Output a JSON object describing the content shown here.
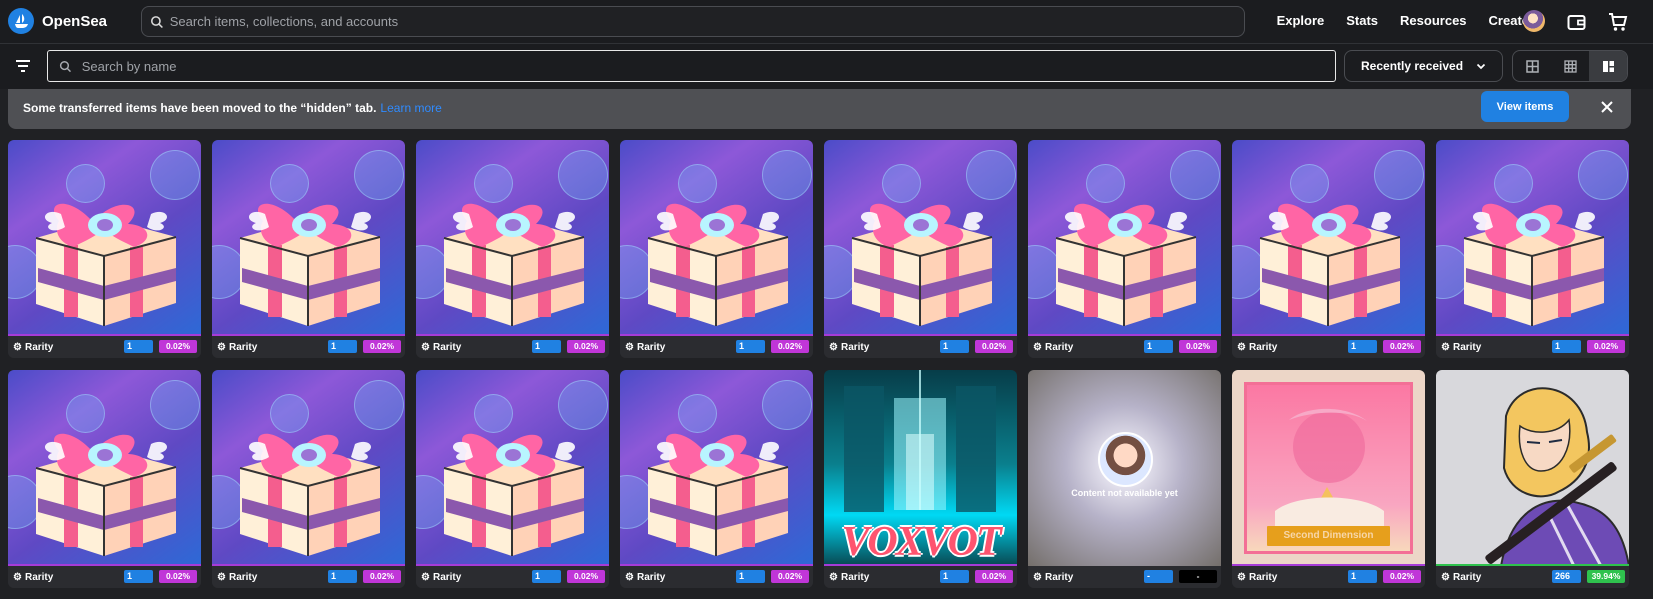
{
  "brand": {
    "name": "OpenSea"
  },
  "header": {
    "search_placeholder": "Search items, collections, and accounts",
    "nav": [
      "Explore",
      "Stats",
      "Resources",
      "Create"
    ]
  },
  "toolbar": {
    "name_search_placeholder": "Search by name",
    "sort_selected": "Recently received"
  },
  "banner": {
    "message": "Some transferred items have been moved to the “hidden” tab.",
    "link": "Learn more",
    "button": "View items"
  },
  "grid": {
    "cards": [
      {
        "rarity_label": "Rarity",
        "rank": "1",
        "percent": "0.02%",
        "media": "gift box"
      },
      {
        "rarity_label": "Rarity",
        "rank": "1",
        "percent": "0.02%",
        "media": "gift box"
      },
      {
        "rarity_label": "Rarity",
        "rank": "1",
        "percent": "0.02%",
        "media": "gift box"
      },
      {
        "rarity_label": "Rarity",
        "rank": "1",
        "percent": "0.02%",
        "media": "gift box"
      },
      {
        "rarity_label": "Rarity",
        "rank": "1",
        "percent": "0.02%",
        "media": "gift box"
      },
      {
        "rarity_label": "Rarity",
        "rank": "1",
        "percent": "0.02%",
        "media": "gift box"
      },
      {
        "rarity_label": "Rarity",
        "rank": "1",
        "percent": "0.02%",
        "media": "gift box"
      },
      {
        "rarity_label": "Rarity",
        "rank": "1",
        "percent": "0.02%",
        "media": "gift box"
      },
      {
        "rarity_label": "Rarity",
        "rank": "1",
        "percent": "0.02%",
        "media": "gift box"
      },
      {
        "rarity_label": "Rarity",
        "rank": "1",
        "percent": "0.02%",
        "media": "gift box"
      },
      {
        "rarity_label": "Rarity",
        "rank": "1",
        "percent": "0.02%",
        "media": "gift box"
      },
      {
        "rarity_label": "Rarity",
        "rank": "1",
        "percent": "0.02%",
        "media": "gift box"
      },
      {
        "rarity_label": "Rarity",
        "rank": "1",
        "percent": "0.02%",
        "media": "VoxVot artwork",
        "title": "VOXVOT"
      },
      {
        "rarity_label": "Rarity",
        "rank": "-",
        "percent": "-",
        "media": "content unavailable",
        "message": "Content not available yet"
      },
      {
        "rarity_label": "Rarity",
        "rank": "1",
        "percent": "0.02%",
        "media": "Second Dimension card",
        "title": "Second Dimension"
      },
      {
        "rarity_label": "Rarity",
        "rank": "266",
        "percent": "39.94%",
        "media": "samurai character"
      }
    ]
  },
  "colors": {
    "accent": "#2081e2",
    "rarity_purple": "#c036d8",
    "rarity_green": "#2fc24e",
    "background": "#202124"
  },
  "icons": [
    "opensea-logo-icon",
    "search-icon",
    "profile-avatar",
    "wallet-icon",
    "cart-icon",
    "filter-icon",
    "chevron-down-icon",
    "large-grid-icon",
    "small-grid-icon",
    "compact-grid-icon",
    "close-icon",
    "rarity-icon"
  ]
}
